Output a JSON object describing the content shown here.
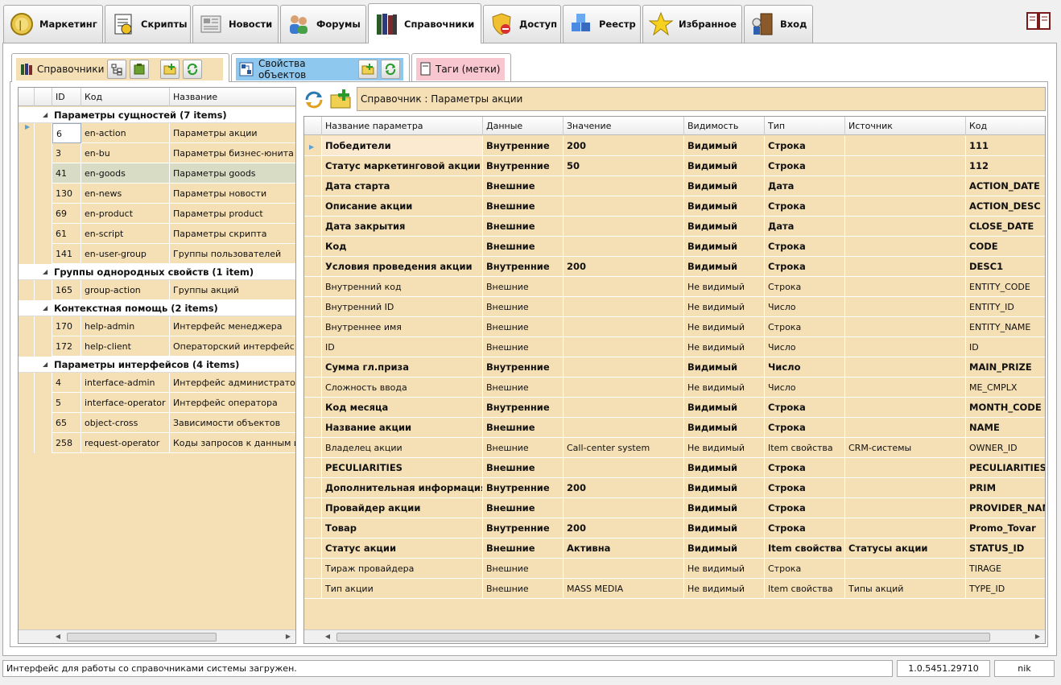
{
  "top_tabs": [
    {
      "label": "Маркетинг",
      "icon": "coin-icon"
    },
    {
      "label": "Скрипты",
      "icon": "script-icon"
    },
    {
      "label": "Новости",
      "icon": "newspaper-icon"
    },
    {
      "label": "Форумы",
      "icon": "users-icon"
    },
    {
      "label": "Справочники",
      "icon": "books-icon"
    },
    {
      "label": "Доступ",
      "icon": "shield-icon"
    },
    {
      "label": "Реестр",
      "icon": "cubes-icon"
    },
    {
      "label": "Избранное",
      "icon": "star-icon"
    },
    {
      "label": "Вход",
      "icon": "door-icon"
    }
  ],
  "sub_tabs": {
    "dictionaries": "Справочники",
    "object_properties": "Свойства объектов",
    "tags": "Таги (метки)"
  },
  "left_grid": {
    "columns": [
      "ID",
      "Код",
      "Название"
    ],
    "groups": [
      {
        "label": "Параметры сущностей (7 items)",
        "rows": [
          {
            "id": "6",
            "code": "en-action",
            "name": "Параметры акции",
            "state": "selected"
          },
          {
            "id": "3",
            "code": "en-bu",
            "name": "Параметры бизнес-юнита"
          },
          {
            "id": "41",
            "code": "en-goods",
            "name": "Параметры goods",
            "state": "hover"
          },
          {
            "id": "130",
            "code": "en-news",
            "name": "Параметры новости"
          },
          {
            "id": "69",
            "code": "en-product",
            "name": "Параметры product"
          },
          {
            "id": "61",
            "code": "en-script",
            "name": "Параметры скрипта"
          },
          {
            "id": "141",
            "code": "en-user-group",
            "name": "Группы пользователей"
          }
        ]
      },
      {
        "label": "Группы однородных свойств (1 item)",
        "rows": [
          {
            "id": "165",
            "code": "group-action",
            "name": "Группы акций"
          }
        ]
      },
      {
        "label": "Контекстная помощь (2 items)",
        "rows": [
          {
            "id": "170",
            "code": "help-admin",
            "name": "Интерфейс менеджера"
          },
          {
            "id": "172",
            "code": "help-client",
            "name": "Операторский интерфейс"
          }
        ]
      },
      {
        "label": "Параметры интерфейсов (4 items)",
        "rows": [
          {
            "id": "4",
            "code": "interface-admin",
            "name": "Интерфейс администратора"
          },
          {
            "id": "5",
            "code": "interface-operator",
            "name": "Интерфейс оператора"
          },
          {
            "id": "65",
            "code": "object-cross",
            "name": "Зависимости объектов"
          },
          {
            "id": "258",
            "code": "request-operator",
            "name": "Коды запросов к данным и"
          }
        ]
      }
    ]
  },
  "right_panel": {
    "title": "Справочник : Параметры акции",
    "columns": [
      "Название параметра",
      "Данные",
      "Значение",
      "Видимость",
      "Тип",
      "Источник",
      "Код"
    ],
    "rows": [
      {
        "bold": true,
        "name": "Победители",
        "data": "Внутренние",
        "value": "200",
        "vis": "Видимый",
        "type": "Строка",
        "src": "",
        "code": "111"
      },
      {
        "bold": true,
        "name": "Статус маркетинговой акции",
        "data": "Внутренние",
        "value": "50",
        "vis": "Видимый",
        "type": "Строка",
        "src": "",
        "code": "112"
      },
      {
        "bold": true,
        "name": "Дата старта",
        "data": "Внешние",
        "value": "",
        "vis": "Видимый",
        "type": "Дата",
        "src": "",
        "code": "ACTION_DATE"
      },
      {
        "bold": true,
        "name": "Описание акции",
        "data": "Внешние",
        "value": "",
        "vis": "Видимый",
        "type": "Строка",
        "src": "",
        "code": "ACTION_DESC"
      },
      {
        "bold": true,
        "name": "Дата закрытия",
        "data": "Внешние",
        "value": "",
        "vis": "Видимый",
        "type": "Дата",
        "src": "",
        "code": "CLOSE_DATE"
      },
      {
        "bold": true,
        "name": "Код",
        "data": "Внешние",
        "value": "",
        "vis": "Видимый",
        "type": "Строка",
        "src": "",
        "code": "CODE"
      },
      {
        "bold": true,
        "name": "Условия проведения акции",
        "data": "Внутренние",
        "value": "200",
        "vis": "Видимый",
        "type": "Строка",
        "src": "",
        "code": "DESC1"
      },
      {
        "bold": false,
        "name": "Внутренний код",
        "data": "Внешние",
        "value": "",
        "vis": "Не видимый",
        "type": "Строка",
        "src": "",
        "code": "ENTITY_CODE"
      },
      {
        "bold": false,
        "name": "Внутренний ID",
        "data": "Внешние",
        "value": "",
        "vis": "Не видимый",
        "type": "Число",
        "src": "",
        "code": "ENTITY_ID"
      },
      {
        "bold": false,
        "name": "Внутреннее имя",
        "data": "Внешние",
        "value": "",
        "vis": "Не видимый",
        "type": "Строка",
        "src": "",
        "code": "ENTITY_NAME"
      },
      {
        "bold": false,
        "name": "ID",
        "data": "Внешние",
        "value": "",
        "vis": "Не видимый",
        "type": "Число",
        "src": "",
        "code": "ID"
      },
      {
        "bold": true,
        "name": "Сумма гл.приза",
        "data": "Внутренние",
        "value": "",
        "vis": "Видимый",
        "type": "Число",
        "src": "",
        "code": "MAIN_PRIZE"
      },
      {
        "bold": false,
        "name": "Сложность ввода",
        "data": "Внешние",
        "value": "",
        "vis": "Не видимый",
        "type": "Число",
        "src": "",
        "code": "ME_CMPLX"
      },
      {
        "bold": true,
        "name": "Код месяца",
        "data": "Внутренние",
        "value": "",
        "vis": "Видимый",
        "type": "Строка",
        "src": "",
        "code": "MONTH_CODE"
      },
      {
        "bold": true,
        "name": "Название акции",
        "data": "Внешние",
        "value": "",
        "vis": "Видимый",
        "type": "Строка",
        "src": "",
        "code": "NAME"
      },
      {
        "bold": false,
        "name": "Владелец акции",
        "data": "Внешние",
        "value": "Call-center system",
        "vis": "Не видимый",
        "type": "Item свойства",
        "src": "CRM-системы",
        "code": "OWNER_ID"
      },
      {
        "bold": true,
        "name": "PECULIARITIES",
        "data": "Внешние",
        "value": "",
        "vis": "Видимый",
        "type": "Строка",
        "src": "",
        "code": "PECULIARITIES"
      },
      {
        "bold": true,
        "name": "Дополнительная информация",
        "data": "Внутренние",
        "value": "200",
        "vis": "Видимый",
        "type": "Строка",
        "src": "",
        "code": "PRIM"
      },
      {
        "bold": true,
        "name": "Провайдер акции",
        "data": "Внешние",
        "value": "",
        "vis": "Видимый",
        "type": "Строка",
        "src": "",
        "code": "PROVIDER_NAME"
      },
      {
        "bold": true,
        "name": "Товар",
        "data": "Внутренние",
        "value": "200",
        "vis": "Видимый",
        "type": "Строка",
        "src": "",
        "code": "Promo_Tovar"
      },
      {
        "bold": true,
        "name": "Статус акции",
        "data": "Внешние",
        "value": "Активна",
        "vis": "Видимый",
        "type": "Item свойства",
        "src": "Статусы акции",
        "code": "STATUS_ID"
      },
      {
        "bold": false,
        "name": "Тираж провайдера",
        "data": "Внешние",
        "value": "",
        "vis": "Не видимый",
        "type": "Строка",
        "src": "",
        "code": "TIRAGE"
      },
      {
        "bold": false,
        "name": "Тип акции",
        "data": "Внешние",
        "value": "MASS MEDIA",
        "vis": "Не видимый",
        "type": "Item свойства",
        "src": "Типы акций",
        "code": "TYPE_ID"
      }
    ]
  },
  "status_bar": {
    "message": "Интерфейс для работы со справочниками системы загружен.",
    "version": "1.0.5451.29710",
    "user": "nik"
  },
  "colors": {
    "grid_bg": "#f5dfb5",
    "selected": "#fbe9d0",
    "hover": "#d8dcc5",
    "blue_tab": "#8ec8ee",
    "pink_tab": "#f7c6cf"
  }
}
